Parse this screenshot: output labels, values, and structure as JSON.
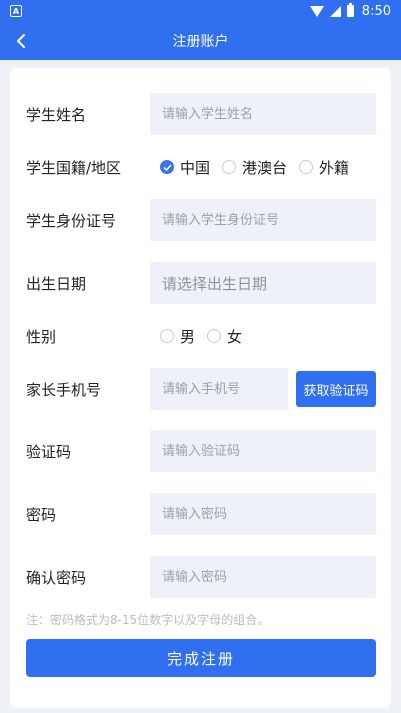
{
  "status_bar": {
    "time": "8:50",
    "notification_icon": "a-badge-icon"
  },
  "appbar": {
    "title": "注册账户",
    "back_icon": "chevron-left-icon"
  },
  "form": {
    "student_name": {
      "label": "学生姓名",
      "placeholder": "请输入学生姓名",
      "value": ""
    },
    "nationality": {
      "label": "学生国籍/地区",
      "options": [
        "中国",
        "港澳台",
        "外籍"
      ],
      "selected": "中国"
    },
    "student_id": {
      "label": "学生身份证号",
      "placeholder": "请输入学生身份证号",
      "value": ""
    },
    "birth_date": {
      "label": "出生日期",
      "placeholder": "请选择出生日期"
    },
    "gender": {
      "label": "性别",
      "options": [
        "男",
        "女"
      ],
      "selected": ""
    },
    "parent_phone": {
      "label": "家长手机号",
      "placeholder": "请输入手机号",
      "value": "",
      "code_button": "获取验证码"
    },
    "verify_code": {
      "label": "验证码",
      "placeholder": "请输入验证码",
      "value": ""
    },
    "password": {
      "label": "密码",
      "placeholder": "请输入密码",
      "value": ""
    },
    "confirm_password": {
      "label": "确认密码",
      "placeholder": "请输入密码",
      "value": ""
    },
    "hint": "注：密码格式为8-15位数字以及字母的组合。",
    "submit_label": "完成注册"
  },
  "colors": {
    "primary": "#2f6ff0",
    "field_bg": "#eef1fa",
    "page_bg": "#eef1f6"
  }
}
